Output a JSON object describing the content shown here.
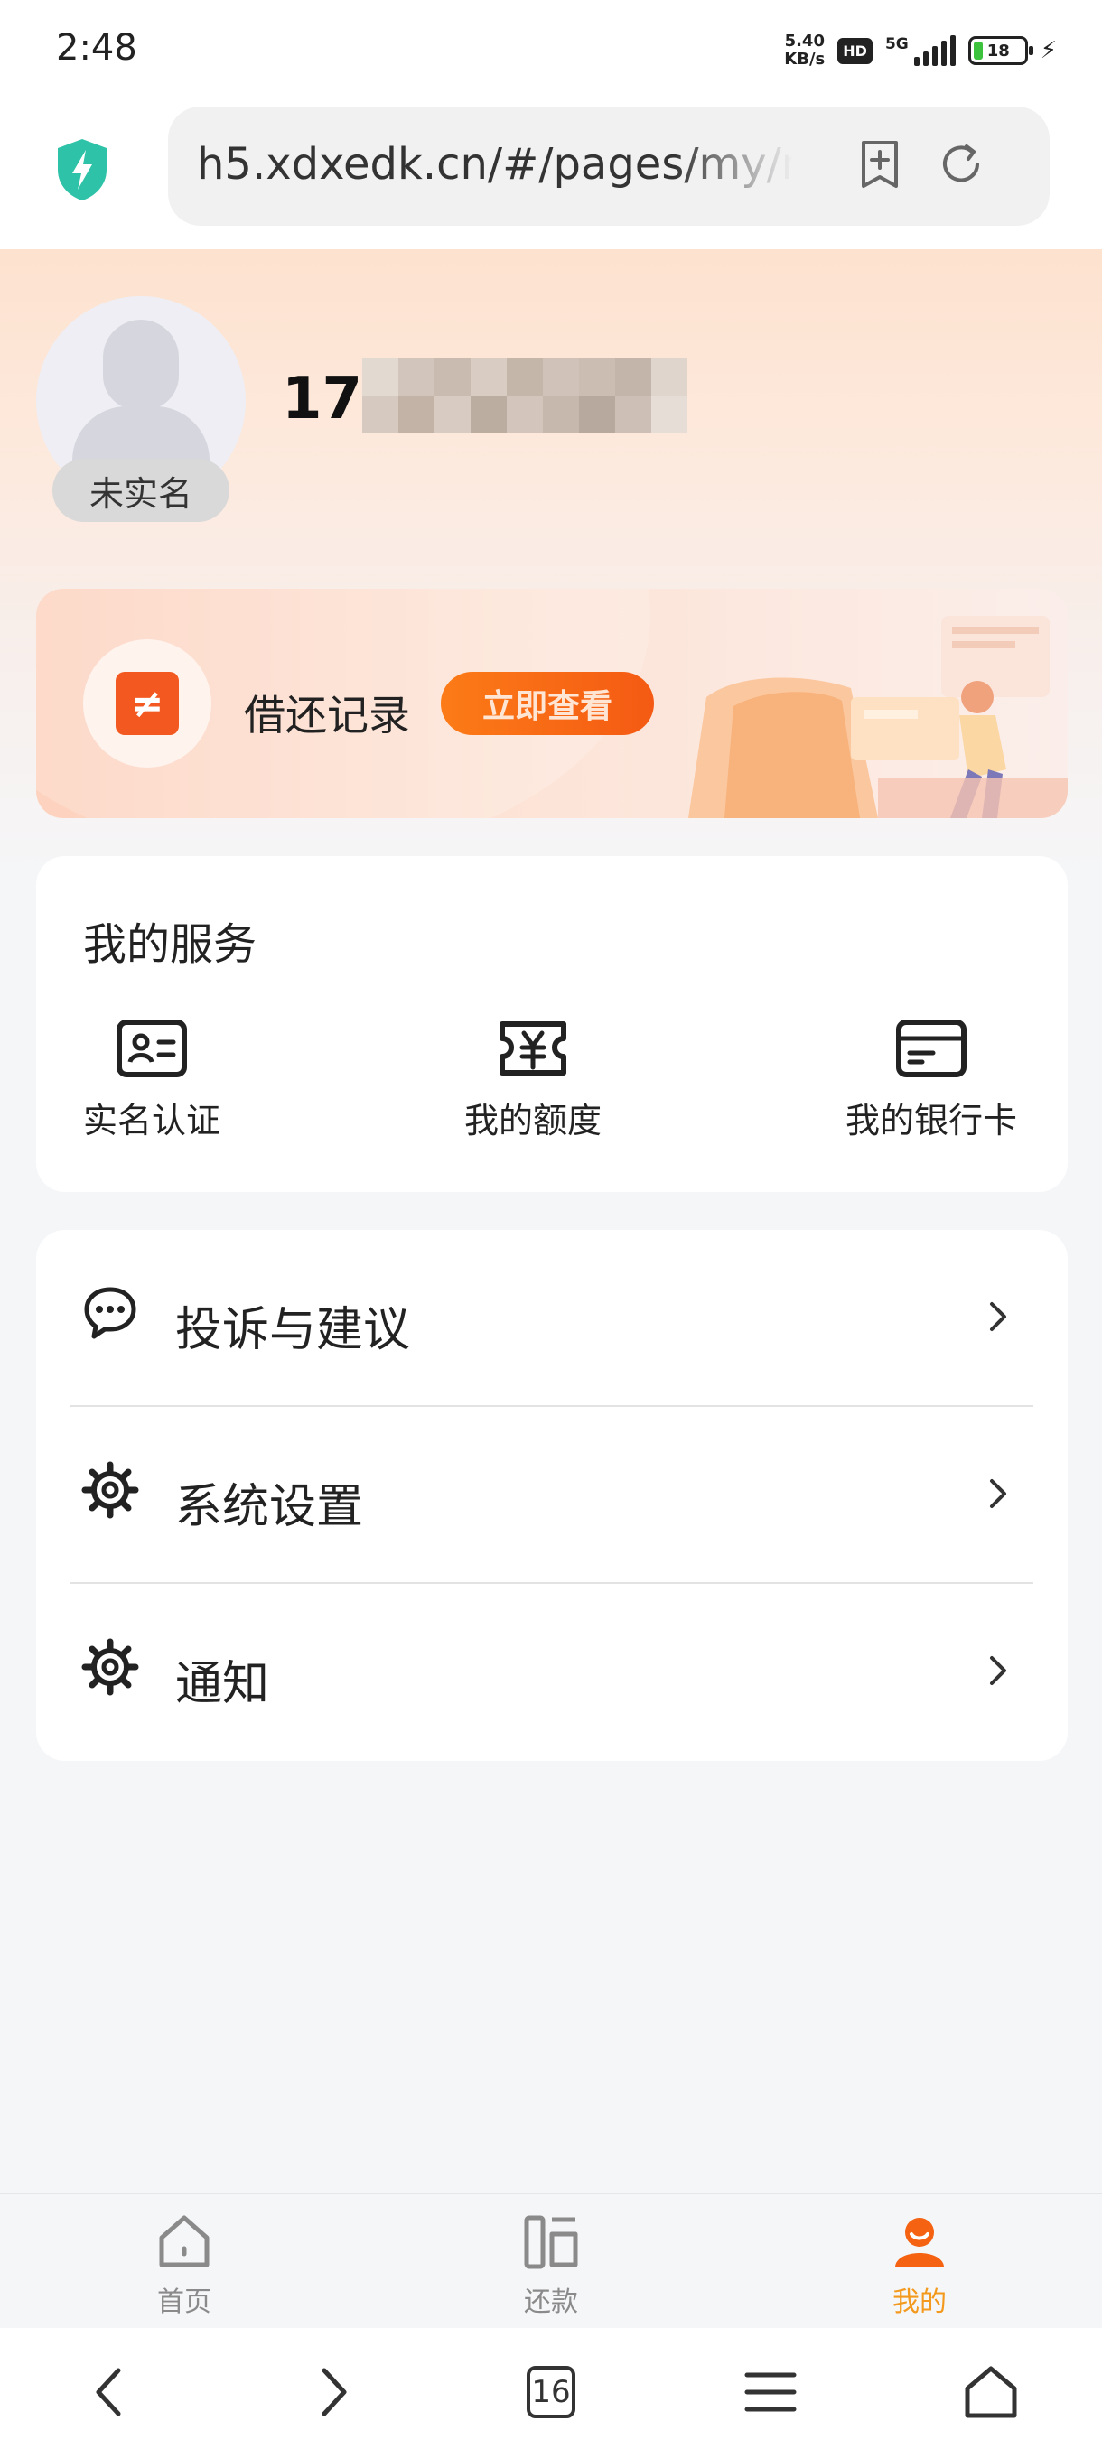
{
  "status_bar": {
    "time": "2:48",
    "net_speed_value": "5.40",
    "net_speed_unit": "KB/s",
    "hd": "HD",
    "network": "5G",
    "battery": "18"
  },
  "browser": {
    "url": "h5.xdxedk.cn/#/pages/my/my",
    "shield_color": "#2ec3a8"
  },
  "profile": {
    "phone_visible": "17",
    "verify_tag": "未实名"
  },
  "banner": {
    "title": "借还记录",
    "button": "立即查看",
    "icon_glyph": "≠"
  },
  "services": {
    "title": "我的服务",
    "items": [
      {
        "label": "实名认证",
        "icon": "id-card-icon"
      },
      {
        "label": "我的额度",
        "icon": "yuan-ticket-icon"
      },
      {
        "label": "我的银行卡",
        "icon": "bank-card-icon"
      }
    ]
  },
  "menu": {
    "items": [
      {
        "label": "投诉与建议",
        "icon": "chat-bubble-icon"
      },
      {
        "label": "系统设置",
        "icon": "gear-icon"
      },
      {
        "label": "通知",
        "icon": "gear-icon"
      }
    ]
  },
  "tabbar": {
    "items": [
      {
        "label": "首页",
        "icon": "home-icon",
        "active": false
      },
      {
        "label": "还款",
        "icon": "repay-icon",
        "active": false
      },
      {
        "label": "我的",
        "icon": "person-icon",
        "active": true
      }
    ],
    "active_color": "#f39a1e",
    "inactive_color": "#8a8a8a"
  },
  "navbar": {
    "tab_count": "16"
  },
  "colors": {
    "accent_orange": "#f45a13",
    "background": "#f5f6f8"
  }
}
